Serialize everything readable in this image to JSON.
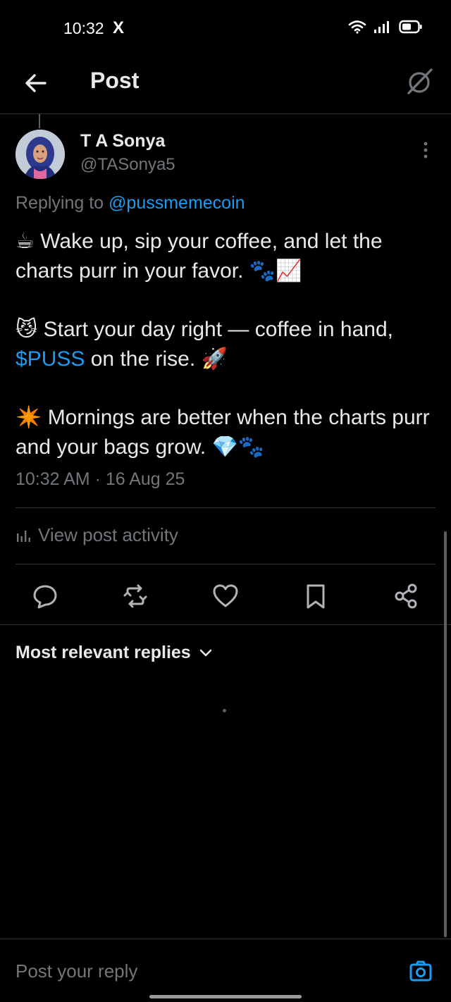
{
  "status_bar": {
    "time": "10:32",
    "x_logo": "X",
    "icons": [
      "wifi-icon",
      "signal-icon",
      "battery-icon"
    ]
  },
  "header": {
    "title": "Post",
    "back_icon": "arrow-left-icon",
    "grok_icon": "grok-icon"
  },
  "post": {
    "author_name": "T A Sonya",
    "author_handle": "@TASonya5",
    "reply_prefix": "Replying to",
    "reply_mention": "@pussmemecoin",
    "paragraph1": "☕ Wake up, sip your coffee, and let the charts purr in your favor. 🐾📈",
    "paragraph2_start": "😼 Start your day right — coffee in hand,",
    "paragraph2_cashtag": "$PUSS",
    "paragraph2_end": "on the rise. 🚀",
    "paragraph3": "✴️ Mornings are better when the charts purr and your bags grow. 💎🐾",
    "timestamp": "10:32 AM · 16 Aug 25"
  },
  "activity": {
    "label": "View post activity",
    "icon": "analytics-icon"
  },
  "actions": [
    "reply-icon",
    "repost-icon",
    "like-icon",
    "bookmark-icon",
    "share-icon"
  ],
  "replies": {
    "sort_label": "Most relevant replies"
  },
  "composer": {
    "placeholder": "Post your reply",
    "camera_icon": "camera-icon"
  },
  "colors": {
    "background": "#000000",
    "text": "#e7e9ea",
    "muted": "#71767b",
    "accent": "#1d9bf0",
    "border": "#2f3336"
  }
}
